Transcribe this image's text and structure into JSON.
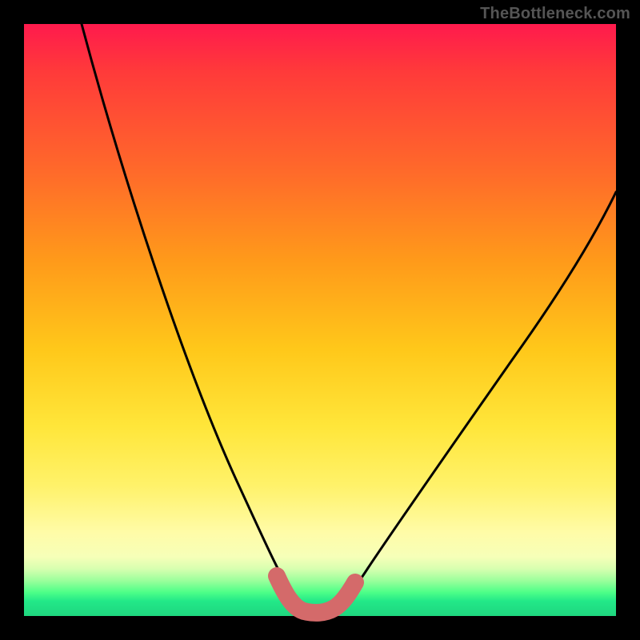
{
  "watermark": "TheBottleneck.com",
  "colors": {
    "background": "#000000",
    "curve": "#000000",
    "valley_highlight": "#d46a6a",
    "gradient_top": "#ff1a4d",
    "gradient_bottom": "#1fd67f"
  },
  "chart_data": {
    "type": "line",
    "title": "",
    "xlabel": "",
    "ylabel": "",
    "xlim": [
      0,
      100
    ],
    "ylim": [
      0,
      100
    ],
    "grid": false,
    "legend": false,
    "background_gradient": {
      "direction": "vertical",
      "stops": [
        {
          "pos": 0,
          "color": "#ff1a4d"
        },
        {
          "pos": 25,
          "color": "#ff6a2a"
        },
        {
          "pos": 55,
          "color": "#ffc81a"
        },
        {
          "pos": 78,
          "color": "#fff26a"
        },
        {
          "pos": 92,
          "color": "#d8ffb0"
        },
        {
          "pos": 100,
          "color": "#1fd67f"
        }
      ]
    },
    "series": [
      {
        "name": "left-curve",
        "x": [
          10,
          15,
          20,
          25,
          30,
          35,
          38,
          40,
          42,
          44,
          46
        ],
        "y": [
          100,
          85,
          70,
          55,
          40,
          25,
          15,
          10,
          6,
          3,
          1
        ]
      },
      {
        "name": "right-curve",
        "x": [
          50,
          52,
          55,
          60,
          65,
          70,
          75,
          80,
          85,
          90,
          95,
          100
        ],
        "y": [
          1,
          3,
          7,
          14,
          22,
          30,
          38,
          46,
          53,
          60,
          66,
          72
        ]
      },
      {
        "name": "valley-highlight",
        "x": [
          40,
          43,
          46,
          48,
          50,
          52,
          54
        ],
        "y": [
          10,
          4,
          1,
          0.5,
          0.5,
          2,
          6
        ],
        "style": "thick-pink"
      }
    ],
    "notes": "No axis ticks or numeric labels are visible; x and y scales are estimated 0–100 from plot geometry. y=0 is the bottom edge of the gradient area, y=100 is the top."
  }
}
